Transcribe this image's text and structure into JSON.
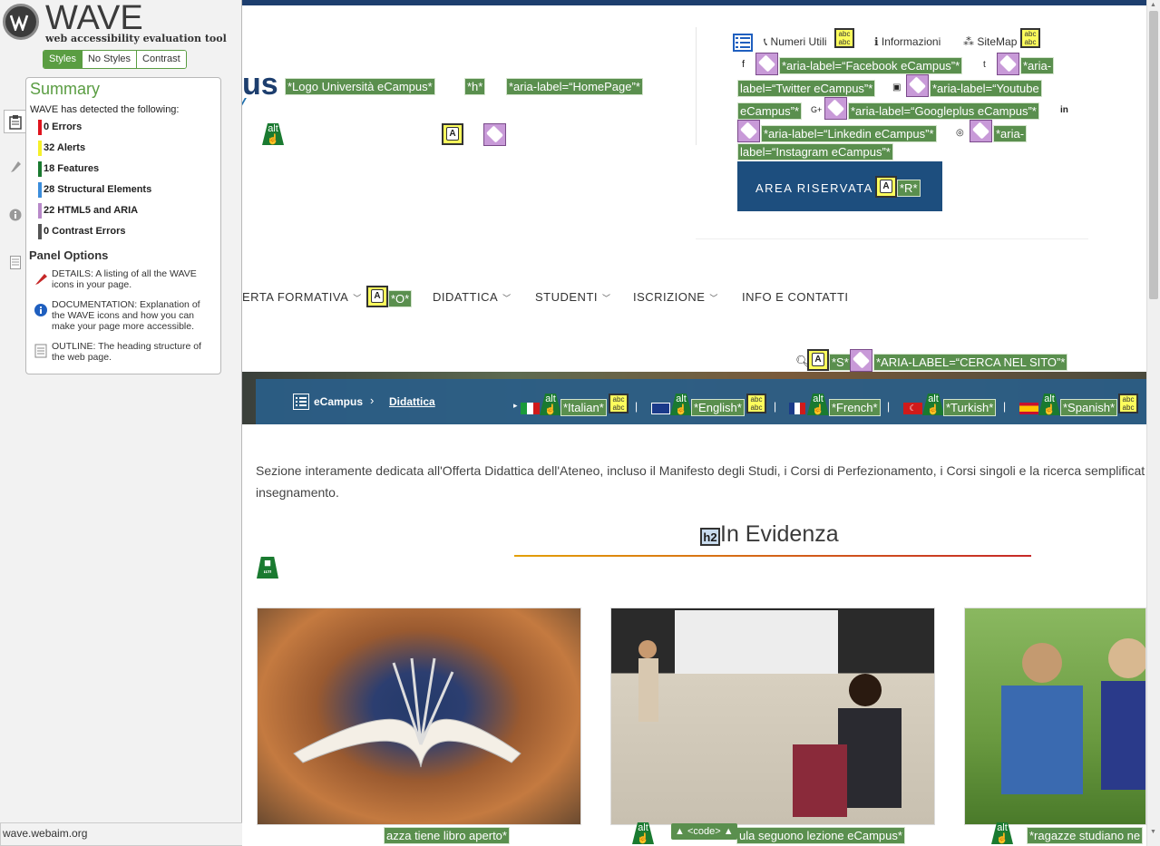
{
  "wave": {
    "title": "WAVE",
    "subtitle": "web accessibility evaluation tool",
    "tabs": [
      "Styles",
      "No Styles",
      "Contrast"
    ],
    "active_tab": "Styles",
    "summary_title": "Summary",
    "detected_text": "WAVE has detected the following:",
    "categories": [
      {
        "label": "0 Errors",
        "color": "#e0141e"
      },
      {
        "label": "32 Alerts",
        "color": "#f5f02a"
      },
      {
        "label": "18 Features",
        "color": "#1a7a30"
      },
      {
        "label": "28 Structural Elements",
        "color": "#3b8ddb"
      },
      {
        "label": "22 HTML5 and ARIA",
        "color": "#b889c9"
      },
      {
        "label": "0 Contrast Errors",
        "color": "#555555"
      }
    ],
    "panel_options_title": "Panel Options",
    "panel_options": [
      "DETAILS: A listing of all the WAVE icons in your page.",
      "DOCUMENTATION: Explanation of the WAVE icons and how you can make your page more accessible.",
      "OUTLINE: The heading structure of the web page."
    ]
  },
  "status_bar": "wave.webaim.org",
  "site": {
    "logo_fragment": "us",
    "logo_labels": [
      "*Logo Università eCampus*",
      "*h*",
      "*aria-label=“HomePage”*"
    ],
    "top_links": [
      "Numeri Utili",
      "Informazioni",
      "SiteMap"
    ],
    "social_labels": [
      "*aria-label=“Facebook eCampus”*",
      "*aria-",
      "label=“Twitter eCampus”*",
      "*aria-label=“Youtube",
      "eCampus”*",
      "*aria-label=“Googleplus eCampus”*",
      "*aria-label=“Linkedin eCampus”*",
      "*aria-",
      "label=“Instagram eCampus”*"
    ],
    "area_riservata": "AREA RISERVATA",
    "area_riservata_key": "*R*",
    "nav": [
      "ERTA FORMATIVA",
      "DIDATTICA",
      "STUDENTI",
      "ISCRIZIONE",
      "INFO E CONTATTI"
    ],
    "nav_key": "*O*",
    "search_key": "*S*",
    "search_label": "*ARIA-LABEL=“CERCA NEL SITO”*",
    "breadcrumb": [
      "eCampus",
      "Didattica"
    ],
    "languages": [
      "*Italian*",
      "*English*",
      "*French*",
      "*Turkish*",
      "*Spanish*"
    ],
    "intro": "Sezione interamente dedicata all'Offerta Didattica dell'Ateneo, incluso il Manifesto degli Studi, i Corsi di Perfezionamento, i Corsi singoli e la ricerca semplificat",
    "intro2": "insegnamento.",
    "h2_badge": "h2",
    "heading": "In Evidenza",
    "captions": [
      "azza tiene libro aperto*",
      "ula seguono lezione eCampus*",
      "*ragazze studiano ne"
    ],
    "code_badge": "<code>"
  }
}
